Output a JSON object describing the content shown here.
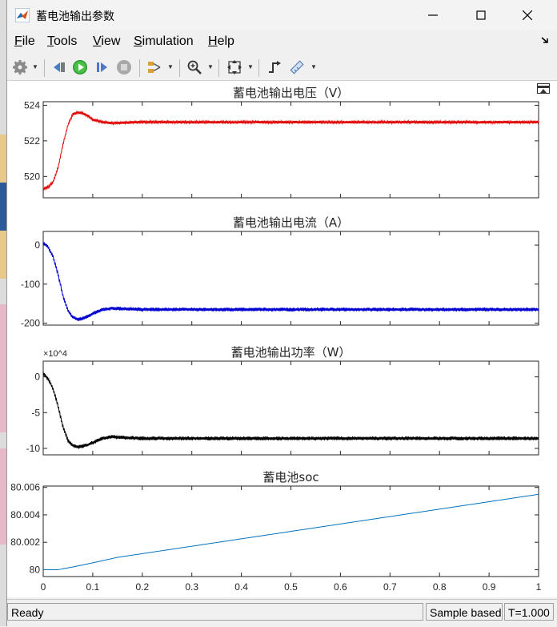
{
  "window": {
    "title": "蓄电池输出参数"
  },
  "menu": [
    {
      "label": "File",
      "key": "F",
      "rest": "ile"
    },
    {
      "label": "Tools",
      "key": "T",
      "rest": "ools"
    },
    {
      "label": "View",
      "key": "V",
      "rest": "iew"
    },
    {
      "label": "Simulation",
      "key": "S",
      "rest": "imulation"
    },
    {
      "label": "Help",
      "key": "H",
      "rest": "elp"
    }
  ],
  "toolbar_icons": [
    "settings-icon",
    "step-back-icon",
    "run-icon",
    "step-forward-icon",
    "stop-icon",
    "signal-selector-icon",
    "zoom-icon",
    "fit-to-view-icon",
    "cursor-measure-icon",
    "triggers-icon"
  ],
  "colors": {
    "voltage": "#e00000",
    "current": "#0000d0",
    "power": "#000000",
    "soc": "#0072bd"
  },
  "chart_data": [
    {
      "type": "line",
      "title": "蓄电池输出电压（V）",
      "xlim": [
        0,
        1
      ],
      "ylim": [
        518.8,
        524.2
      ],
      "yticks": [
        520,
        522,
        524
      ],
      "x": [
        0,
        0.01,
        0.02,
        0.03,
        0.04,
        0.05,
        0.06,
        0.07,
        0.08,
        0.09,
        0.1,
        0.12,
        0.14,
        0.16,
        0.2,
        0.3,
        0.5,
        1.0
      ],
      "y": [
        519.3,
        519.4,
        519.7,
        520.5,
        521.8,
        522.9,
        523.5,
        523.6,
        523.55,
        523.4,
        523.2,
        523.05,
        523.0,
        523.02,
        523.06,
        523.05,
        523.05,
        523.05
      ],
      "noise": 0.08
    },
    {
      "type": "line",
      "title": "蓄电池输出电流（A）",
      "xlim": [
        0,
        1
      ],
      "ylim": [
        -205,
        35
      ],
      "yticks": [
        0,
        -100,
        -200
      ],
      "x": [
        0,
        0.01,
        0.02,
        0.03,
        0.04,
        0.05,
        0.06,
        0.07,
        0.08,
        0.09,
        0.1,
        0.12,
        0.14,
        0.16,
        0.2,
        0.3,
        0.5,
        1.0
      ],
      "y": [
        5,
        -5,
        -30,
        -75,
        -130,
        -168,
        -185,
        -190,
        -188,
        -183,
        -175,
        -165,
        -162,
        -163,
        -165,
        -165,
        -165,
        -165
      ],
      "noise": 5
    },
    {
      "type": "line",
      "title": "蓄电池输出功率（W）",
      "exponent": "×10^4",
      "xlim": [
        0,
        1
      ],
      "ylim": [
        -10.9,
        2.2
      ],
      "yticks": [
        0,
        -5,
        -10
      ],
      "x": [
        0,
        0.01,
        0.02,
        0.03,
        0.04,
        0.05,
        0.06,
        0.07,
        0.08,
        0.09,
        0.1,
        0.12,
        0.14,
        0.16,
        0.2,
        0.3,
        0.5,
        1.0
      ],
      "y": [
        0.5,
        -0.3,
        -1.7,
        -4.1,
        -7.0,
        -8.9,
        -9.6,
        -9.8,
        -9.7,
        -9.5,
        -9.2,
        -8.6,
        -8.4,
        -8.5,
        -8.6,
        -8.6,
        -8.6,
        -8.6
      ],
      "noise": 0.28
    },
    {
      "type": "line",
      "title": "蓄电池soc",
      "xlim": [
        0,
        1
      ],
      "ylim": [
        79.9995,
        80.0061
      ],
      "yticks": [
        80,
        80.002,
        80.004,
        80.006
      ],
      "yticklabels": [
        "80",
        "80.002",
        "80.004",
        "80.006"
      ],
      "x": [
        0,
        0.03,
        0.06,
        0.1,
        0.15,
        1.0
      ],
      "y": [
        80.0,
        80.0,
        80.0002,
        80.0005,
        80.0009,
        80.0055
      ],
      "xticks": [
        0,
        0.1,
        0.2,
        0.3,
        0.4,
        0.5,
        0.6,
        0.7,
        0.8,
        0.9,
        1
      ],
      "xticklabels": [
        "0",
        "0.1",
        "0.2",
        "0.3",
        "0.4",
        "0.5",
        "0.6",
        "0.7",
        "0.8",
        "0.9",
        "1"
      ]
    }
  ],
  "status": {
    "left": "Ready",
    "mode": "Sample based",
    "time": "T=1.000"
  }
}
